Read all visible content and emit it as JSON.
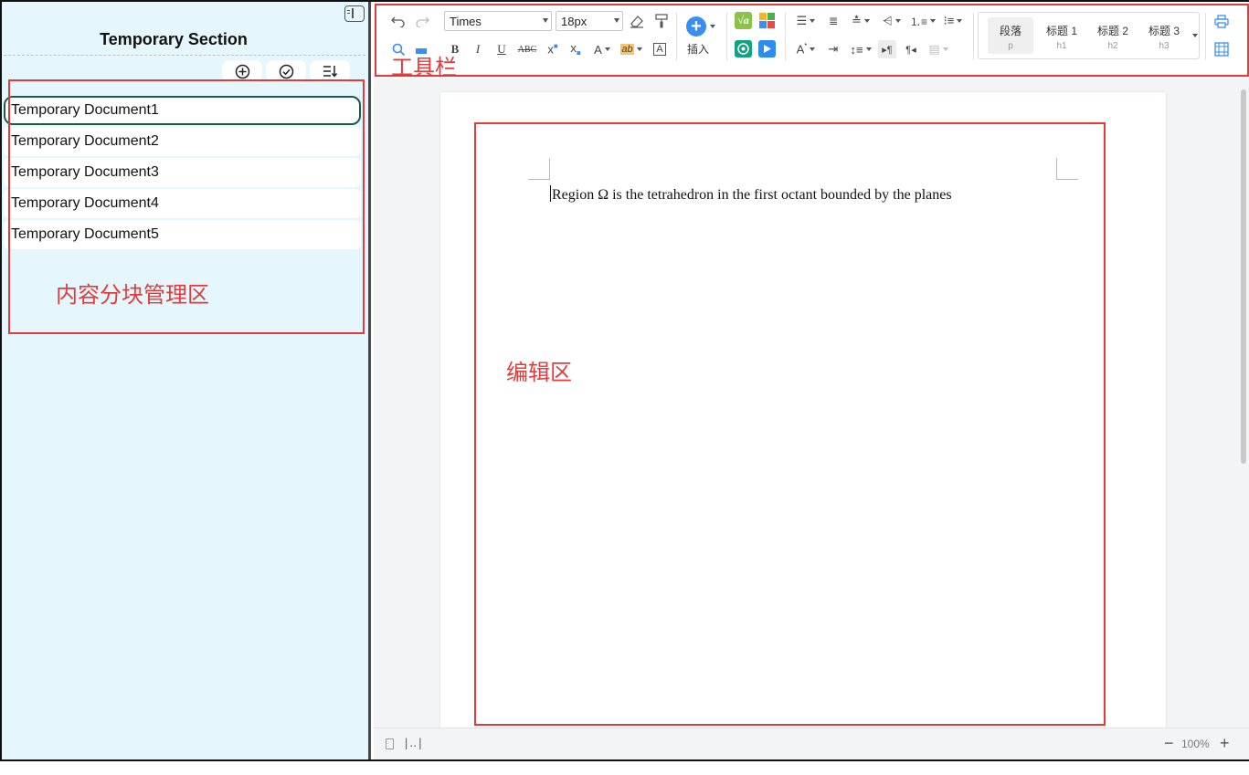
{
  "sidebar": {
    "title": "Temporary Section",
    "documents": [
      {
        "label": "Temporary Document1",
        "active": true
      },
      {
        "label": "Temporary Document2",
        "active": false
      },
      {
        "label": "Temporary Document3",
        "active": false
      },
      {
        "label": "Temporary Document4",
        "active": false
      },
      {
        "label": "Temporary Document5",
        "active": false
      }
    ]
  },
  "toolbar": {
    "font_family": "Times",
    "font_size": "18px",
    "insert_label": "插入",
    "styles": [
      {
        "label": "段落",
        "tag": "p"
      },
      {
        "label": "标题 1",
        "tag": "h1"
      },
      {
        "label": "标题 2",
        "tag": "h2"
      },
      {
        "label": "标题 3",
        "tag": "h3"
      }
    ]
  },
  "annotations": {
    "toolbar_label": "工具栏",
    "sidebar_label": "内容分块管理区",
    "editor_label": "编辑区"
  },
  "editor": {
    "text": "Region Ω is the tetrahedron in the first octant bounded by the planes"
  },
  "statusbar": {
    "zoom": "100%"
  },
  "colors": {
    "sidebar_bg": "#e6f6fd",
    "annotation_red": "#e23b3b",
    "active_border": "#1e5b46",
    "accent_blue": "#3a8ef0"
  }
}
